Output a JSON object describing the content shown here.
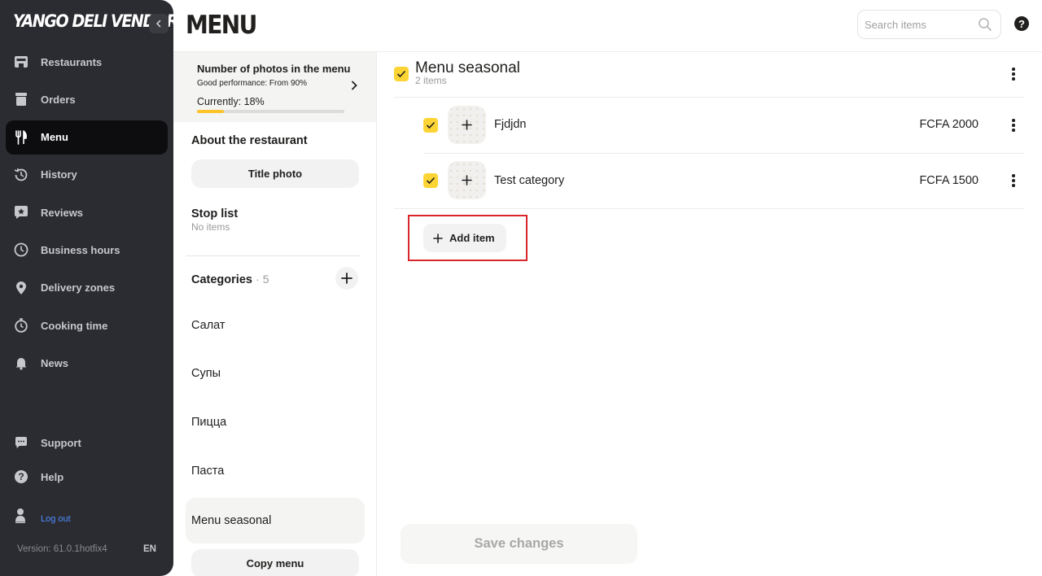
{
  "sidebar": {
    "brand": "YANGO DELI VENDOR",
    "items": [
      {
        "label": "Restaurants",
        "icon": "store-icon",
        "active": false
      },
      {
        "label": "Orders",
        "icon": "orders-icon",
        "active": false
      },
      {
        "label": "Menu",
        "icon": "fork-knife-icon",
        "active": true
      },
      {
        "label": "History",
        "icon": "history-icon",
        "active": false
      },
      {
        "label": "Reviews",
        "icon": "star-bubble-icon",
        "active": false
      },
      {
        "label": "Business hours",
        "icon": "clock-icon",
        "active": false
      },
      {
        "label": "Delivery zones",
        "icon": "location-pin-icon",
        "active": false
      },
      {
        "label": "Cooking time",
        "icon": "stopwatch-icon",
        "active": false
      },
      {
        "label": "News",
        "icon": "bell-icon",
        "active": false
      }
    ],
    "bottom_items": [
      {
        "label": "Support",
        "icon": "chat-icon"
      },
      {
        "label": "Help",
        "icon": "question-icon"
      }
    ],
    "logout": "Log out",
    "version": "Version: 61.0.1hotfix4",
    "language": "EN"
  },
  "header": {
    "title": "MENU",
    "search_placeholder": "Search items",
    "help": "?"
  },
  "photos": {
    "title": "Number of photos in the menu",
    "subtitle": "Good performance: From 90%",
    "current": "Currently: 18%",
    "progress_fraction": 0.18
  },
  "about": {
    "heading": "About the restaurant",
    "title_photo_button": "Title photo"
  },
  "stop_list": {
    "heading": "Stop list",
    "subtitle": "No items"
  },
  "categories": {
    "heading": "Categories",
    "separator": "·",
    "count": "5",
    "items": [
      {
        "label": "Салат",
        "active": false
      },
      {
        "label": "Супы",
        "active": false
      },
      {
        "label": "Пицца",
        "active": false
      },
      {
        "label": "Паста",
        "active": false
      },
      {
        "label": "Menu seasonal",
        "active": true
      }
    ],
    "copy_menu_button": "Copy menu"
  },
  "main": {
    "category_title": "Menu seasonal",
    "category_count": "2 items",
    "items": [
      {
        "name": "Fjdjdn",
        "price": "FCFA 2000",
        "checked": true
      },
      {
        "name": "Test category",
        "price": "FCFA 1500",
        "checked": true
      }
    ],
    "add_item_button": "Add item",
    "save_button": "Save changes"
  },
  "colors": {
    "accent_yellow": "#fcd535",
    "sidebar_bg": "#2b2c31",
    "highlight_red": "#d9262b"
  }
}
